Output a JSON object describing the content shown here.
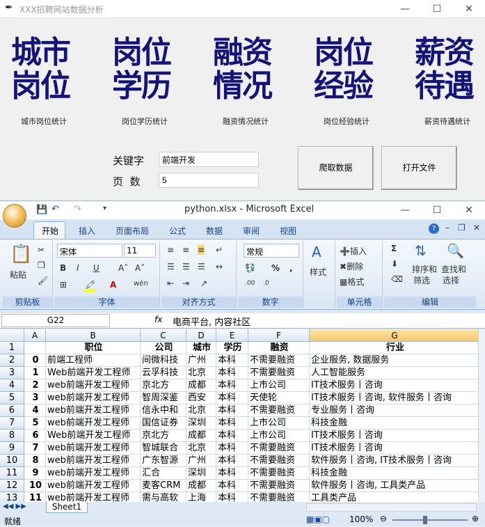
{
  "app": {
    "title": "XXX招聘网站数据分析"
  },
  "tiles": [
    {
      "line1": "城市",
      "line2": "岗位",
      "caption": "城市岗位统计"
    },
    {
      "line1": "岗位",
      "line2": "学历",
      "caption": "岗位学历统计"
    },
    {
      "line1": "融资",
      "line2": "情况",
      "caption": "融资情况统计"
    },
    {
      "line1": "岗位",
      "line2": "经验",
      "caption": "岗位经验统计"
    },
    {
      "line1": "薪资",
      "line2": "待遇",
      "caption": "薪资待遇统计"
    }
  ],
  "form": {
    "keyword_label": "关键字",
    "keyword_value": "前端开发",
    "pages_label": "页  数",
    "pages_value": "5",
    "crawl_button": "爬取数据",
    "open_button": "打开文件"
  },
  "excel": {
    "title": "python.xlsx - Microsoft Excel",
    "tabs": [
      "开始",
      "插入",
      "页面布局",
      "公式",
      "数据",
      "审阅",
      "视图"
    ],
    "ribbon": {
      "clipboard": {
        "paste": "粘贴",
        "group": "剪贴板"
      },
      "font": {
        "name": "宋体",
        "size": "11",
        "group": "字体"
      },
      "align": {
        "group": "对齐方式"
      },
      "number": {
        "format": "常规",
        "group": "数字"
      },
      "style": {
        "label": "样式"
      },
      "cells": {
        "insert": "插入",
        "delete": "删除",
        "format": "格式",
        "group": "单元格"
      },
      "edit": {
        "sort": "排序和",
        "sort2": "筛选",
        "find": "查找和",
        "find2": "选择",
        "group": "编辑"
      }
    },
    "namebox": "G22",
    "fx": "fx",
    "formula": "电商平台, 内容社区",
    "columns": [
      "A",
      "B",
      "C",
      "D",
      "E",
      "F",
      "G"
    ],
    "header_row": [
      "",
      "职位",
      "公司",
      "城市",
      "学历",
      "融资",
      "行业"
    ],
    "rows": [
      [
        "0",
        "前端工程师",
        "间微科技",
        "广州",
        "本科",
        "不需要融资",
        "企业服务, 数据服务"
      ],
      [
        "1",
        "Web前端开发工程师",
        "云孚科技",
        "北京",
        "本科",
        "不需要融资",
        "人工智能服务"
      ],
      [
        "2",
        "web前端开发工程师",
        "京北方",
        "成都",
        "本科",
        "上市公司",
        "IT技术服务丨咨询"
      ],
      [
        "3",
        "web前端开发工程师",
        "智周深鉴",
        "西安",
        "本科",
        "天使轮",
        "IT技术服务丨咨询, 软件服务丨咨询"
      ],
      [
        "4",
        "web前端开发工程师",
        "信永中和",
        "北京",
        "本科",
        "不需要融资",
        "专业服务丨咨询"
      ],
      [
        "5",
        "web前端开发工程师",
        "国信证券",
        "深圳",
        "本科",
        "上市公司",
        "科技金融"
      ],
      [
        "6",
        "Web前端开发工程师",
        "京北方",
        "成都",
        "本科",
        "上市公司",
        "IT技术服务丨咨询"
      ],
      [
        "7",
        "web前端开发工程师",
        "智城联合",
        "北京",
        "本科",
        "不需要融资",
        "IT技术服务丨咨询"
      ],
      [
        "8",
        "web前端开发工程师",
        "广东智源",
        "广州",
        "本科",
        "不需要融资",
        "软件服务丨咨询, IT技术服务丨咨询"
      ],
      [
        "9",
        "web前端开发工程师",
        "汇合",
        "深圳",
        "本科",
        "不需要融资",
        "科技金融"
      ],
      [
        "10",
        "web前端开发工程师",
        "麦客CRM",
        "成都",
        "本科",
        "不需要融资",
        "软件服务丨咨询, 工具类产品"
      ],
      [
        "11",
        "web前端开发工程师",
        "需与高软",
        "上海",
        "本科",
        "不需要融资",
        "工具类产品"
      ]
    ],
    "sheet_tab": "Sheet1",
    "status": "就绪",
    "zoom": "100%"
  }
}
